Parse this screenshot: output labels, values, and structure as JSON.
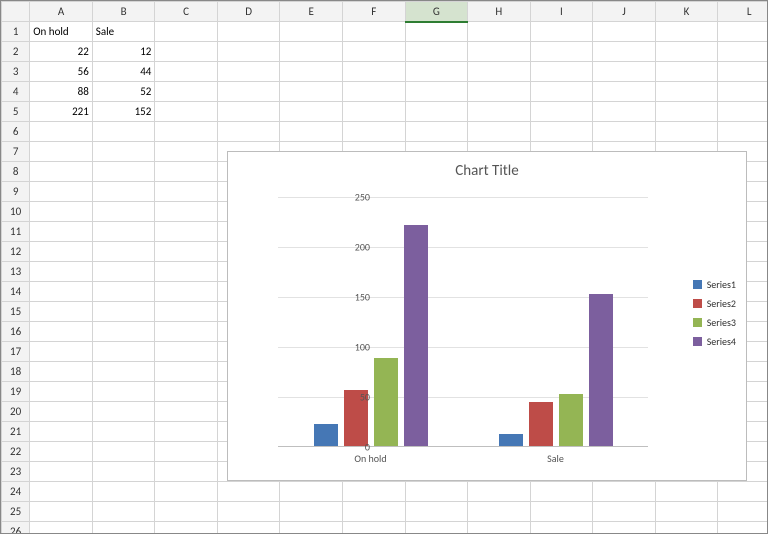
{
  "columns": [
    "A",
    "B",
    "C",
    "D",
    "E",
    "F",
    "G",
    "H",
    "I",
    "J",
    "K",
    "L"
  ],
  "selected_column": "G",
  "rows": 26,
  "cells": {
    "A1": "On hold",
    "B1": "Sale",
    "A2": "22",
    "B2": "12",
    "A3": "56",
    "B3": "44",
    "A4": "88",
    "B4": "52",
    "A5": "221",
    "B5": "152"
  },
  "text_cells": [
    "A1",
    "B1"
  ],
  "chart": {
    "title": "Chart Title",
    "legend": [
      "Series1",
      "Series2",
      "Series3",
      "Series4"
    ]
  },
  "chart_data": {
    "type": "bar",
    "title": "Chart Title",
    "categories": [
      "On hold",
      "Sale"
    ],
    "series": [
      {
        "name": "Series1",
        "values": [
          22,
          12
        ]
      },
      {
        "name": "Series2",
        "values": [
          56,
          44
        ]
      },
      {
        "name": "Series3",
        "values": [
          88,
          52
        ]
      },
      {
        "name": "Series4",
        "values": [
          221,
          152
        ]
      }
    ],
    "ylim": [
      0,
      250
    ],
    "yticks": [
      0,
      50,
      100,
      150,
      200,
      250
    ],
    "xlabel": "",
    "ylabel": ""
  }
}
